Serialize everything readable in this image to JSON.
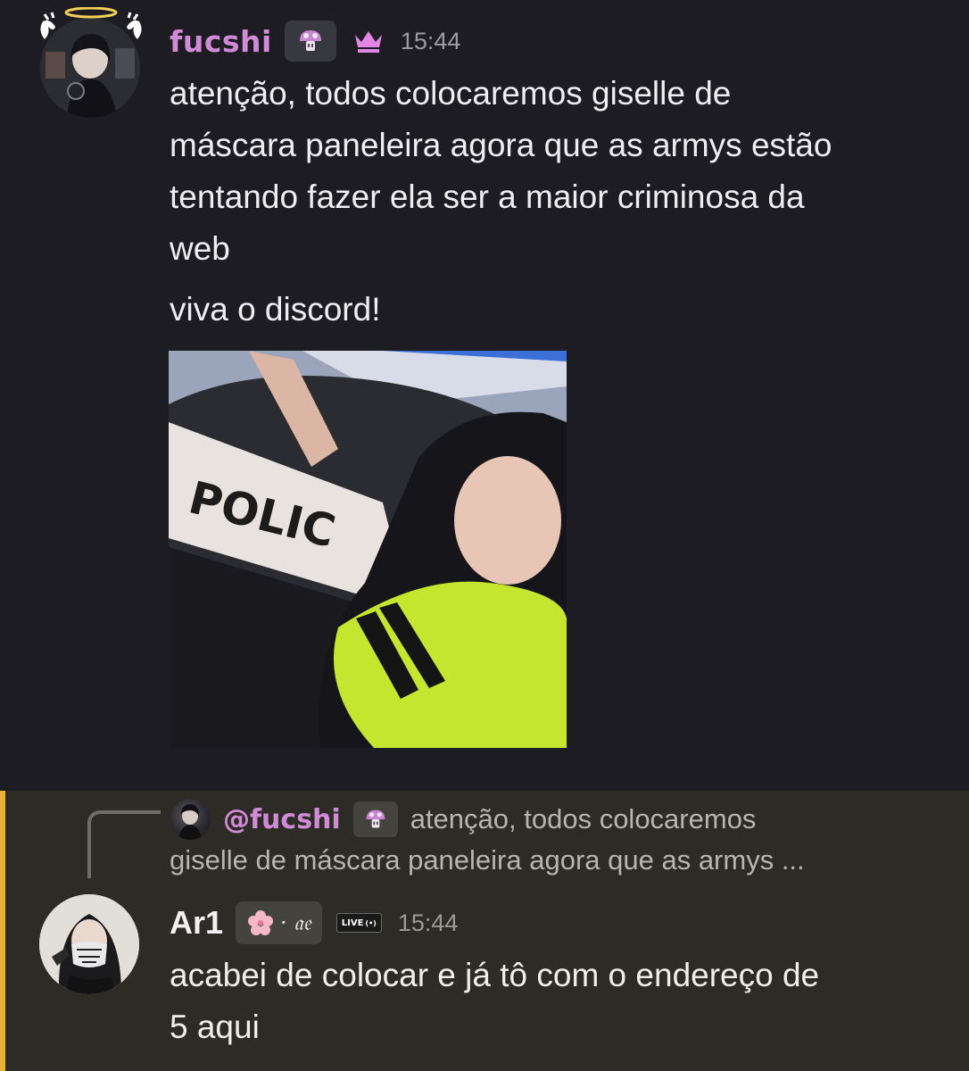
{
  "message1": {
    "username": "fucshi",
    "tag_icon": "mushroom-icon",
    "role_icon": "crown-icon",
    "timestamp": "15:44",
    "text_lines": "atenção, todos colocaremos giselle de\nmáscara paneleira agora que as armys estão\ntentando fazer ela ser a maior criminosa da\nweb",
    "text_second": "viva o discord!",
    "gif_text": "POLIC"
  },
  "message2": {
    "reply": {
      "mention": "@fucshi",
      "tag_icon": "mushroom-icon",
      "preview_line1": "atenção, todos colocaremos",
      "preview_line2": "giselle de máscara paneleira agora que as armys ..."
    },
    "username": "Ar1",
    "tag_text": "· 𝔞𝔢",
    "tag_icon": "cherry-blossom-icon",
    "live_badge": "LIVE",
    "timestamp": "15:44",
    "text": "acabei de colocar e já tô com o endereço de\n5 aqui"
  },
  "colors": {
    "background": "#1c1c22",
    "highlight_background": "#2d2b26",
    "highlight_bar": "#e7b238",
    "username_pink": "#d18ad6",
    "timestamp": "#9b9ba4"
  }
}
